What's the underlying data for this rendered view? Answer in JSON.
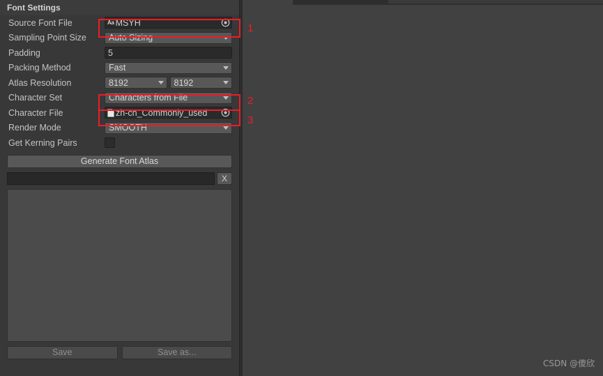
{
  "panel": {
    "header": "Font Settings"
  },
  "rows": {
    "source_font_file": {
      "label": "Source Font File",
      "value": "MSYH",
      "icon": "font-aa-icon",
      "picker": "object-picker-icon"
    },
    "sampling_point_size": {
      "label": "Sampling Point Size",
      "value": "Auto Sizing"
    },
    "padding": {
      "label": "Padding",
      "value": "5"
    },
    "packing_method": {
      "label": "Packing Method",
      "value": "Fast"
    },
    "atlas_resolution": {
      "label": "Atlas Resolution",
      "width": "8192",
      "height": "8192"
    },
    "character_set": {
      "label": "Character Set",
      "value": "Characters from File"
    },
    "character_file": {
      "label": "Character File",
      "value": "zh-cn_Commonly_used",
      "icon": "text-file-icon",
      "picker": "object-picker-icon"
    },
    "render_mode": {
      "label": "Render Mode",
      "value": "SMOOTH"
    },
    "get_kerning_pairs": {
      "label": "Get Kerning Pairs",
      "checked": false
    }
  },
  "buttons": {
    "generate": "Generate Font Atlas",
    "clear": "X",
    "save": "Save",
    "save_as": "Save as..."
  },
  "annotations": {
    "marker_1": "1",
    "marker_2": "2",
    "marker_3": "3",
    "color": "#ee1c25"
  },
  "watermark": "CSDN @傻欣"
}
